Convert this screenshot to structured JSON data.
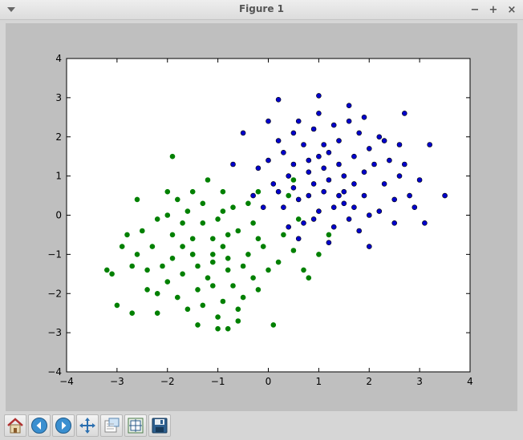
{
  "window": {
    "title": "Figure 1",
    "menu_icon": "dropdown-arrow-icon",
    "minimize_symbol": "−",
    "maximize_symbol": "+",
    "close_symbol": "×"
  },
  "toolbar": {
    "buttons": [
      {
        "name": "home",
        "icon": "home-icon"
      },
      {
        "name": "back",
        "icon": "back-arrow-icon"
      },
      {
        "name": "forward",
        "icon": "forward-arrow-icon"
      },
      {
        "name": "pan",
        "icon": "pan-arrows-icon"
      },
      {
        "name": "zoom",
        "icon": "zoom-rect-icon"
      },
      {
        "name": "configure-subplots",
        "icon": "subplots-icon"
      },
      {
        "name": "save",
        "icon": "floppy-disk-icon"
      }
    ]
  },
  "chart_data": {
    "type": "scatter",
    "title": "",
    "xlabel": "",
    "ylabel": "",
    "xlim": [
      -4,
      4
    ],
    "ylim": [
      -4,
      4
    ],
    "xticks": [
      -4,
      -3,
      -2,
      -1,
      0,
      1,
      2,
      3,
      4
    ],
    "yticks": [
      -4,
      -3,
      -2,
      -1,
      0,
      1,
      2,
      3,
      4
    ],
    "xtick_labels": [
      "−4",
      "−3",
      "−2",
      "−1",
      "0",
      "1",
      "2",
      "3",
      "4"
    ],
    "ytick_labels": [
      "−4",
      "−3",
      "−2",
      "−1",
      "0",
      "1",
      "2",
      "3",
      "4"
    ],
    "grid": false,
    "legend": "none",
    "series": [
      {
        "color": "#0000cc",
        "edge_color": "#000000",
        "points": [
          [
            1.2,
            0.9
          ],
          [
            0.8,
            1.4
          ],
          [
            1.5,
            0.6
          ],
          [
            0.6,
            0.4
          ],
          [
            1.9,
            1.1
          ],
          [
            1.1,
            1.8
          ],
          [
            0.4,
            1.0
          ],
          [
            1.7,
            0.2
          ],
          [
            2.3,
            0.8
          ],
          [
            1.0,
            0.1
          ],
          [
            0.3,
            1.6
          ],
          [
            1.4,
            1.3
          ],
          [
            2.0,
            1.7
          ],
          [
            0.9,
            2.2
          ],
          [
            1.6,
            2.4
          ],
          [
            0.7,
            -0.2
          ],
          [
            1.3,
            -0.3
          ],
          [
            2.6,
            1.0
          ],
          [
            -0.2,
            1.2
          ],
          [
            0.2,
            0.6
          ],
          [
            1.8,
            -0.4
          ],
          [
            2.2,
            0.1
          ],
          [
            1.0,
            2.6
          ],
          [
            0.5,
            2.1
          ],
          [
            2.8,
            0.5
          ],
          [
            3.5,
            0.5
          ],
          [
            3.2,
            1.8
          ],
          [
            2.7,
            2.6
          ],
          [
            1.0,
            3.05
          ],
          [
            0.2,
            2.95
          ],
          [
            1.6,
            2.8
          ],
          [
            -0.5,
            2.1
          ],
          [
            -0.7,
            1.3
          ],
          [
            2.5,
            -0.2
          ],
          [
            2.0,
            -0.8
          ],
          [
            1.2,
            -0.7
          ],
          [
            0.6,
            -0.6
          ],
          [
            3.1,
            -0.2
          ],
          [
            2.9,
            0.2
          ],
          [
            1.4,
            0.5
          ],
          [
            0.9,
            0.8
          ],
          [
            1.1,
            1.2
          ],
          [
            1.7,
            1.5
          ],
          [
            0.5,
            1.3
          ],
          [
            1.3,
            0.2
          ],
          [
            2.1,
            1.3
          ],
          [
            0.1,
            0.8
          ],
          [
            0.8,
            0.5
          ],
          [
            1.5,
            1.0
          ],
          [
            2.4,
            1.4
          ],
          [
            0.3,
            0.2
          ],
          [
            1.9,
            0.5
          ],
          [
            1.2,
            1.6
          ],
          [
            0.7,
            1.8
          ],
          [
            2.2,
            2.0
          ],
          [
            1.6,
            -0.1
          ],
          [
            0.0,
            1.4
          ],
          [
            0.9,
            -0.1
          ],
          [
            2.5,
            0.4
          ],
          [
            1.4,
            1.9
          ],
          [
            0.6,
            2.4
          ],
          [
            1.8,
            2.1
          ],
          [
            -0.3,
            0.5
          ],
          [
            0.4,
            -0.3
          ],
          [
            2.0,
            0.0
          ],
          [
            1.1,
            0.6
          ],
          [
            1.7,
            0.8
          ],
          [
            0.2,
            1.9
          ],
          [
            2.7,
            1.3
          ],
          [
            1.3,
            2.3
          ],
          [
            0.8,
            1.1
          ],
          [
            1.5,
            0.3
          ],
          [
            1.0,
            1.5
          ],
          [
            0.5,
            0.7
          ],
          [
            2.3,
            1.9
          ],
          [
            1.9,
            2.5
          ],
          [
            -0.1,
            0.2
          ],
          [
            3.0,
            0.9
          ],
          [
            2.6,
            1.8
          ],
          [
            0.0,
            2.4
          ]
        ]
      },
      {
        "color": "#008000",
        "edge_color": "#008000",
        "points": [
          [
            -1.1,
            -1.0
          ],
          [
            -0.8,
            -1.4
          ],
          [
            -1.5,
            -0.6
          ],
          [
            -0.6,
            -0.4
          ],
          [
            -1.9,
            -1.1
          ],
          [
            -1.1,
            -1.8
          ],
          [
            -0.4,
            -1.0
          ],
          [
            -1.7,
            -0.2
          ],
          [
            -2.3,
            -0.8
          ],
          [
            -1.0,
            -0.1
          ],
          [
            -0.3,
            -1.6
          ],
          [
            -1.4,
            -1.3
          ],
          [
            -2.0,
            -1.7
          ],
          [
            -0.9,
            -2.2
          ],
          [
            -1.6,
            -2.4
          ],
          [
            -0.7,
            0.2
          ],
          [
            -1.3,
            0.3
          ],
          [
            -2.6,
            -1.0
          ],
          [
            0.2,
            -1.2
          ],
          [
            -0.2,
            -0.6
          ],
          [
            -1.8,
            0.4
          ],
          [
            -2.2,
            -0.1
          ],
          [
            -1.0,
            -2.6
          ],
          [
            -0.5,
            -2.1
          ],
          [
            -2.8,
            -0.5
          ],
          [
            -3.0,
            -2.3
          ],
          [
            -3.1,
            -1.5
          ],
          [
            -2.6,
            0.4
          ],
          [
            -2.0,
            0.6
          ],
          [
            -1.2,
            0.9
          ],
          [
            -0.8,
            -2.9
          ],
          [
            -1.4,
            -2.8
          ],
          [
            0.1,
            -2.8
          ],
          [
            0.7,
            -1.4
          ],
          [
            1.2,
            -0.5
          ],
          [
            0.4,
            0.5
          ],
          [
            -2.9,
            -0.8
          ],
          [
            -2.4,
            -1.9
          ],
          [
            -1.5,
            -1.0
          ],
          [
            -0.9,
            -0.8
          ],
          [
            -1.1,
            -1.2
          ],
          [
            -1.7,
            -1.5
          ],
          [
            -0.5,
            -1.3
          ],
          [
            -1.3,
            -0.2
          ],
          [
            -2.1,
            -1.3
          ],
          [
            -0.1,
            -0.8
          ],
          [
            -0.8,
            -0.5
          ],
          [
            -1.5,
            -1.0
          ],
          [
            -2.4,
            -1.4
          ],
          [
            -0.3,
            -0.2
          ],
          [
            -1.9,
            -0.5
          ],
          [
            -1.2,
            -1.6
          ],
          [
            -0.7,
            -1.8
          ],
          [
            -2.2,
            -2.0
          ],
          [
            -1.6,
            0.1
          ],
          [
            0.0,
            -1.4
          ],
          [
            -0.9,
            0.1
          ],
          [
            -2.5,
            -0.4
          ],
          [
            -1.4,
            -1.9
          ],
          [
            -0.6,
            -2.4
          ],
          [
            -1.8,
            -2.1
          ],
          [
            0.3,
            -0.5
          ],
          [
            -0.4,
            0.3
          ],
          [
            -2.0,
            0.0
          ],
          [
            -1.1,
            -0.6
          ],
          [
            -1.7,
            -0.8
          ],
          [
            -0.2,
            -1.9
          ],
          [
            -2.7,
            -1.3
          ],
          [
            -1.3,
            -2.3
          ],
          [
            -0.8,
            -1.1
          ],
          [
            0.5,
            -0.9
          ],
          [
            1.0,
            -1.0
          ],
          [
            0.8,
            -1.6
          ],
          [
            -0.2,
            0.6
          ],
          [
            0.6,
            -0.1
          ],
          [
            -1.9,
            1.5
          ],
          [
            -1.5,
            0.6
          ],
          [
            -0.9,
            0.6
          ],
          [
            0.5,
            0.9
          ],
          [
            -2.2,
            -2.5
          ],
          [
            -3.2,
            -1.4
          ],
          [
            -1.0,
            -2.9
          ],
          [
            -2.7,
            -2.5
          ],
          [
            -0.6,
            -2.7
          ]
        ]
      }
    ]
  }
}
